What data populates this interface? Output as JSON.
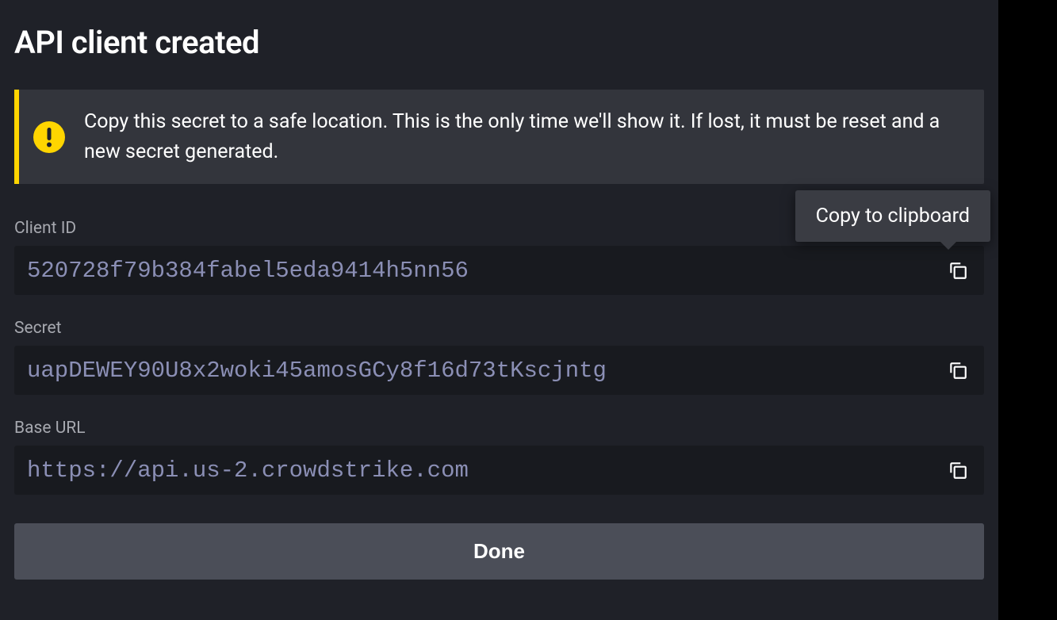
{
  "modal": {
    "title": "API client created",
    "alert": {
      "icon_name": "warning-icon",
      "message": "Copy this secret to a safe location. This is the only time we'll show it. If lost, it must be reset and a new secret generated."
    },
    "fields": {
      "client_id": {
        "label": "Client ID",
        "value": "520728f79b384fabel5eda9414h5nn56"
      },
      "secret": {
        "label": "Secret",
        "value": "uapDEWEY90U8x2woki45amosGCy8f16d73tKscjntg"
      },
      "base_url": {
        "label": "Base URL",
        "value": "https://api.us-2.crowdstrike.com"
      }
    },
    "tooltip": "Copy to clipboard",
    "done_label": "Done"
  }
}
